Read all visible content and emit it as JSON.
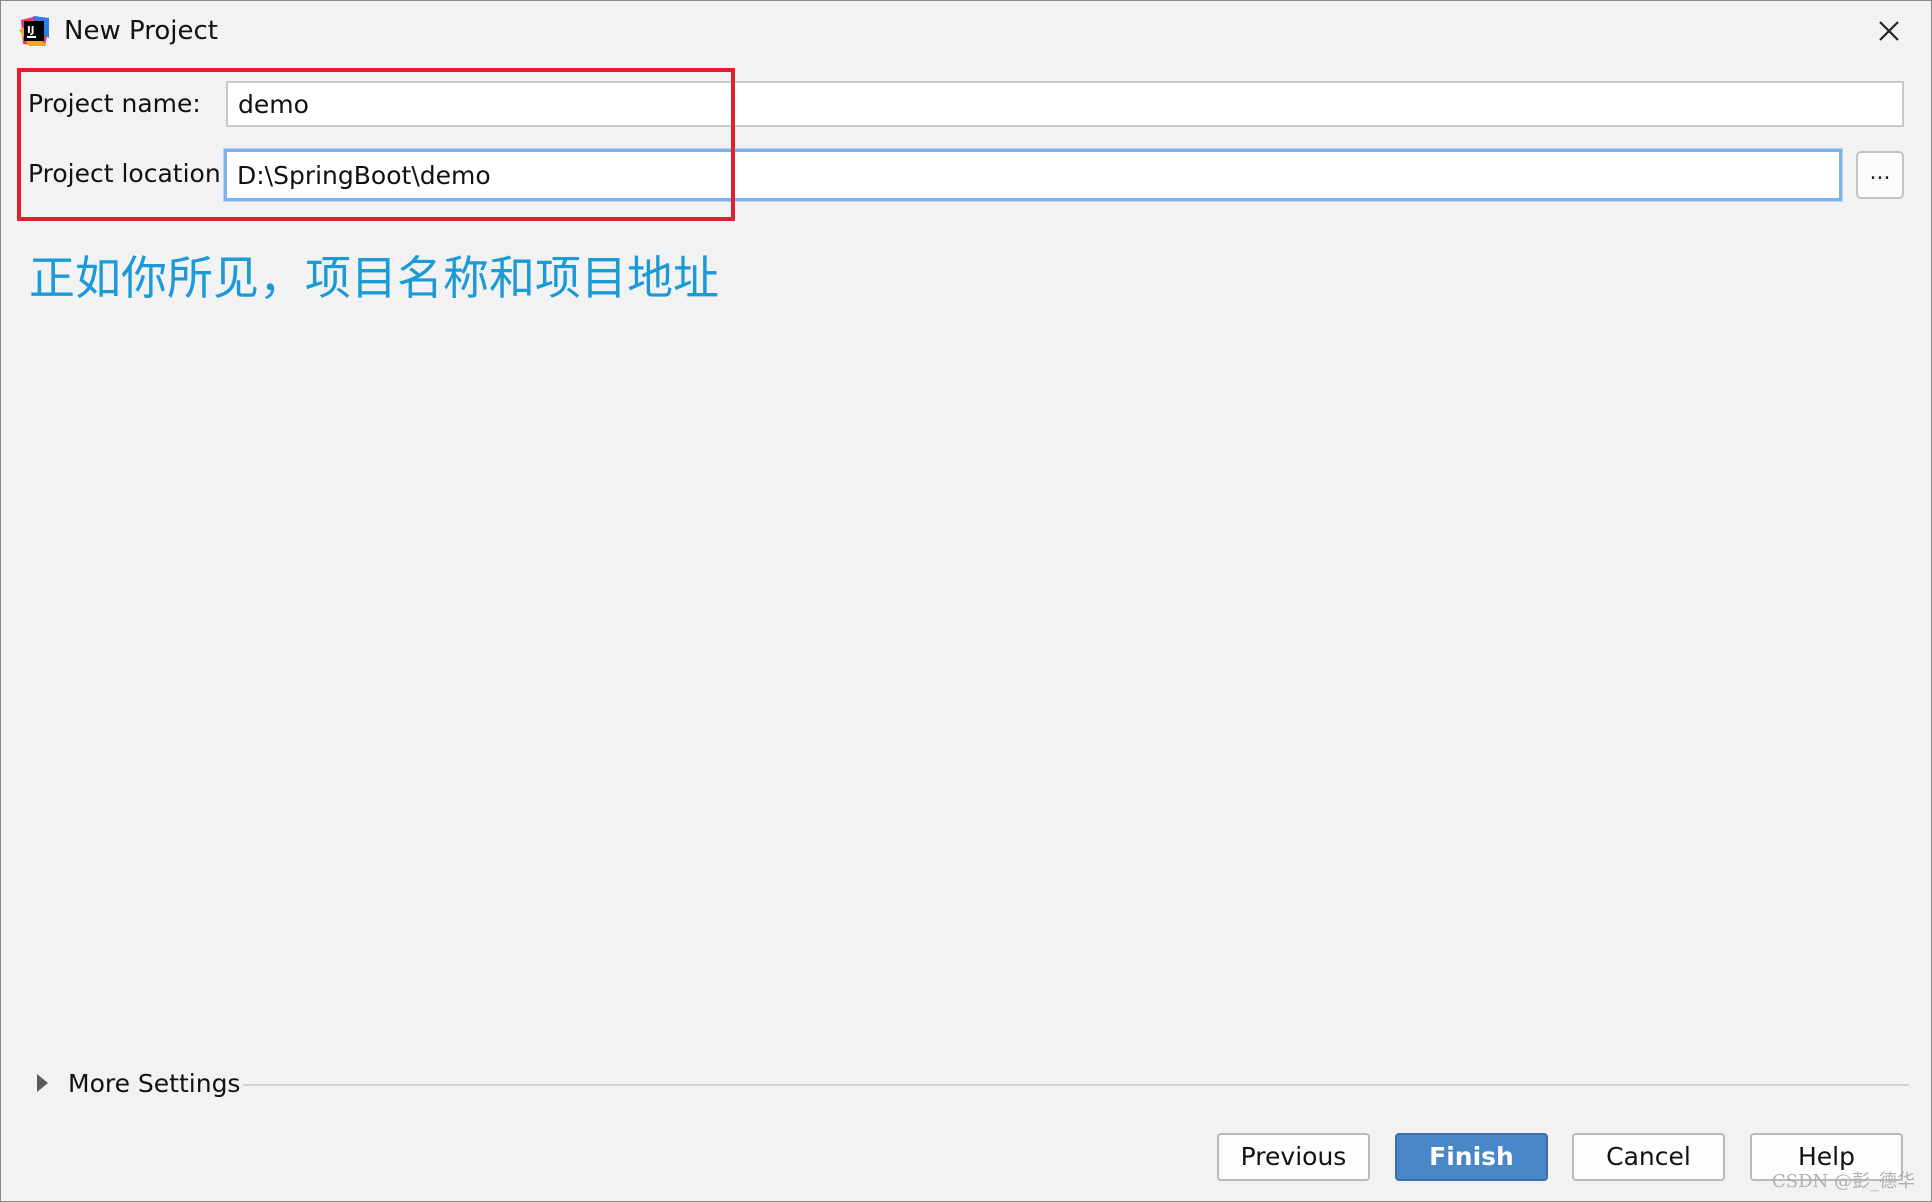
{
  "window": {
    "title": "New Project",
    "icon": "intellij-idea-icon"
  },
  "form": {
    "project_name_label": "Project name:",
    "project_name_value": "demo",
    "project_location_label": "Project location:",
    "project_location_value": "D:\\SpringBoot\\demo",
    "browse_label": "..."
  },
  "annotation": {
    "text": "正如你所见，项目名称和项目地址",
    "box_color": "#e0202c",
    "text_color": "#1b9ad8"
  },
  "more_settings": {
    "label": "More Settings"
  },
  "buttons": {
    "previous": "Previous",
    "finish": "Finish",
    "cancel": "Cancel",
    "help": "Help"
  },
  "watermark": "CSDN @彭_德华",
  "colors": {
    "accent": "#4a87c9",
    "focus_border": "#7fb1e6",
    "background": "#f2f2f2"
  }
}
